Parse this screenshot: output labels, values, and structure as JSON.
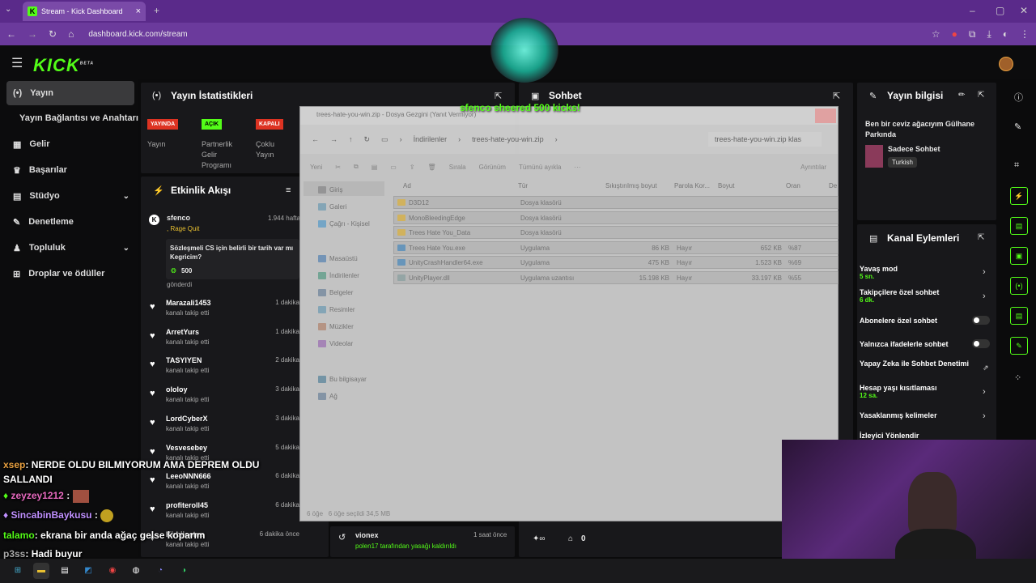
{
  "browser": {
    "tab_title": "Stream - Kick Dashboard",
    "url": "dashboard.kick.com/stream"
  },
  "brand": {
    "logo": "KICK",
    "beta": "BETA",
    "accent": "#53fc18"
  },
  "sidebar": {
    "items": [
      {
        "label": "Yayın",
        "icon": "broadcast-icon"
      },
      {
        "label": "Yayın Bağlantısı ve Anahtarı"
      },
      {
        "label": "Gelir",
        "icon": "bank-icon"
      },
      {
        "label": "Başarılar",
        "icon": "trophy-icon"
      },
      {
        "label": "Stüdyo",
        "icon": "studio-icon"
      },
      {
        "label": "Denetleme",
        "icon": "wrench-icon"
      },
      {
        "label": "Topluluk",
        "icon": "community-icon"
      },
      {
        "label": "Droplar ve ödüller",
        "icon": "gift-icon"
      }
    ]
  },
  "stats": {
    "title": "Yayın İstatistikleri",
    "badges": [
      {
        "text": "YAYINDA",
        "label": "Yayın"
      },
      {
        "text": "AÇIK",
        "label": "Partnerlik Gelir Programı"
      },
      {
        "text": "KAPALI",
        "label": "Çoklu Yayın"
      }
    ]
  },
  "activity": {
    "title": "Etkinlik Akışı",
    "sub": {
      "user": "sfenco",
      "time": "1.944 hafta",
      "tier": ", Rage Quit",
      "message": "Sözleşmeli CS için belirli bir tarih var mı Kegricim?",
      "amount": "500",
      "status": "gönderdi"
    },
    "rows": [
      {
        "name": "Marazali1453",
        "sub": "kanalı takip etti",
        "time": "1 dakika"
      },
      {
        "name": "ArretYurs",
        "sub": "kanalı takip etti",
        "time": "1 dakika"
      },
      {
        "name": "TASYIYEN",
        "sub": "kanalı takip etti",
        "time": "2 dakika"
      },
      {
        "name": "ololoy",
        "sub": "kanalı takip etti",
        "time": "3 dakika"
      },
      {
        "name": "LordCyberX",
        "sub": "kanalı takip etti",
        "time": "3 dakika"
      },
      {
        "name": "Vesvesebey",
        "sub": "kanalı takip etti",
        "time": "5 dakika"
      },
      {
        "name": "LeeoNNN666",
        "sub": "kanalı takip etti",
        "time": "6 dakika"
      },
      {
        "name": "profiteroll45",
        "sub": "kanalı takip etti",
        "time": "6 dakika"
      },
      {
        "name": "Kirbijoctus",
        "sub": "kanalı takip etti",
        "time": "6 dakika önce"
      }
    ]
  },
  "chat": {
    "title": "Sohbet",
    "alert": "sfenco sheered 500 kicks!",
    "ban_user": "vionex",
    "ban_text": "polen17 tarafından yasağı kaldırıldı",
    "ban_time": "1 saat önce",
    "footer_count": "0"
  },
  "overlay_chat": [
    {
      "user": "xsep",
      "text": ": NERDE OLDU BILMIYORUM AMA DEPREM OLDU SALLANDI",
      "color": "#e8a040"
    },
    {
      "user": "zeyzey1212",
      "text": " :",
      "color": "#e86ac0"
    },
    {
      "user": "SincabinBaykusu",
      "text": " :",
      "color": "#c090ff"
    },
    {
      "user": "talamo",
      "text": ": ekrana bir anda ağaç gelse koparım",
      "color": "#53fc18"
    },
    {
      "user": "p3ss",
      "text": ": Hadi buyur",
      "color": "#aaaaaa"
    }
  ],
  "stream_info": {
    "title": "Yayın bilgisi",
    "stream_title": "Ben bir ceviz ağacıyım Gülhane Parkında",
    "category": "Sadece Sohbet",
    "language": "Turkish"
  },
  "channel_actions": {
    "title": "Kanal Eylemleri",
    "items": [
      {
        "label": "Yavaş mod",
        "value": "5 sn."
      },
      {
        "label": "Takipçilere özel sohbet",
        "value": "6 dk."
      },
      {
        "label": "Abonelere özel sohbet"
      },
      {
        "label": "Yalnızca ifadelerle sohbet"
      },
      {
        "label": "Yapay Zeka ile Sohbet Denetimi"
      },
      {
        "label": "Hesap yaşı kısıtlaması",
        "value": "12 sa."
      },
      {
        "label": "Yasaklanmış kelimeler"
      },
      {
        "label": "İzleyici Yönlendir"
      }
    ]
  },
  "explorer": {
    "title": "trees-hate-you-win.zip - Dosya Gezgini (Yanıt Vermiyor)",
    "path": [
      "İndirilenler",
      "trees-hate-you-win.zip"
    ],
    "search": "trees-hate-you-win.zip klas",
    "toolbar": [
      "Yeni",
      "Sırala",
      "Görünüm",
      "Tümünü ayıkla",
      "Ayrıntılar"
    ],
    "nav": [
      "Giriş",
      "Galeri",
      "Çağrı - Kişisel",
      "Masaüstü",
      "İndirilenler",
      "Belgeler",
      "Resimler",
      "Müzikler",
      "Videolar",
      "Bu bilgisayar",
      "Ağ"
    ],
    "columns": [
      "Ad",
      "Tür",
      "Sıkıştırılmış boyut",
      "Parola Kor...",
      "Boyut",
      "Oran",
      "De"
    ],
    "files": [
      {
        "name": "D3D12",
        "type": "Dosya klasörü",
        "csize": "",
        "pw": "",
        "size": "",
        "ratio": "",
        "kind": "folder"
      },
      {
        "name": "MonoBleedingEdge",
        "type": "Dosya klasörü",
        "csize": "",
        "pw": "",
        "size": "",
        "ratio": "",
        "kind": "folder"
      },
      {
        "name": "Trees Hate You_Data",
        "type": "Dosya klasörü",
        "csize": "",
        "pw": "",
        "size": "",
        "ratio": "",
        "kind": "folder"
      },
      {
        "name": "Trees Hate You.exe",
        "type": "Uygulama",
        "csize": "86 KB",
        "pw": "Hayır",
        "size": "652 KB",
        "ratio": "%87",
        "kind": "app"
      },
      {
        "name": "UnityCrashHandler64.exe",
        "type": "Uygulama",
        "csize": "475 KB",
        "pw": "Hayır",
        "size": "1.523 KB",
        "ratio": "%69",
        "kind": "app"
      },
      {
        "name": "UnityPlayer.dll",
        "type": "Uygulama uzantısı",
        "csize": "15.198 KB",
        "pw": "Hayır",
        "size": "33.197 KB",
        "ratio": "%55",
        "kind": "dll"
      }
    ],
    "status": [
      "6 öğe",
      "6 öğe seçildi  34,5 MB"
    ]
  }
}
